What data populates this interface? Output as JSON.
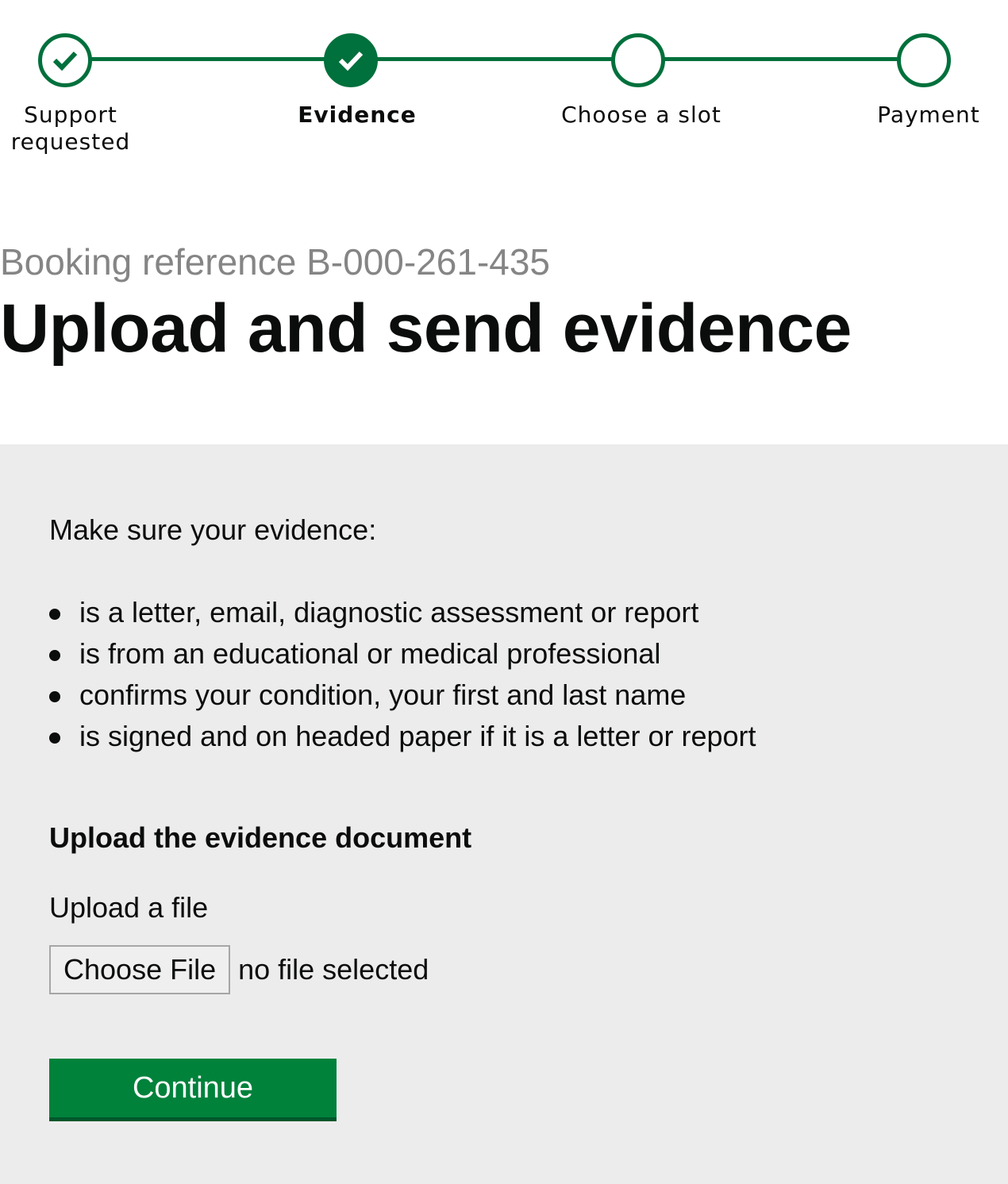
{
  "stepper": {
    "steps": [
      {
        "label_line1": "Support",
        "label_line2": "requested",
        "state": "done"
      },
      {
        "label": "Evidence",
        "state": "current"
      },
      {
        "label": "Choose a slot",
        "state": "todo"
      },
      {
        "label": "Payment",
        "state": "todo"
      }
    ],
    "check_icon": "check-icon"
  },
  "header": {
    "caption": "Booking reference B-000-261-435",
    "title": "Upload and send evidence"
  },
  "evidence": {
    "intro": "Make sure your evidence:",
    "bullets": [
      "is a letter, email, diagnostic assessment or report",
      "is from an educational or medical professional",
      "confirms your condition, your first and last name",
      "is signed and on headed paper if it is a letter or report"
    ]
  },
  "upload": {
    "heading": "Upload the evidence document",
    "label": "Upload a file",
    "choose_button": "Choose File",
    "status": "no file selected"
  },
  "actions": {
    "continue_label": "Continue"
  },
  "colors": {
    "brand_green": "#00703c",
    "button_green": "#00823b",
    "panel_grey": "#ececec",
    "caption_grey": "#858585"
  }
}
